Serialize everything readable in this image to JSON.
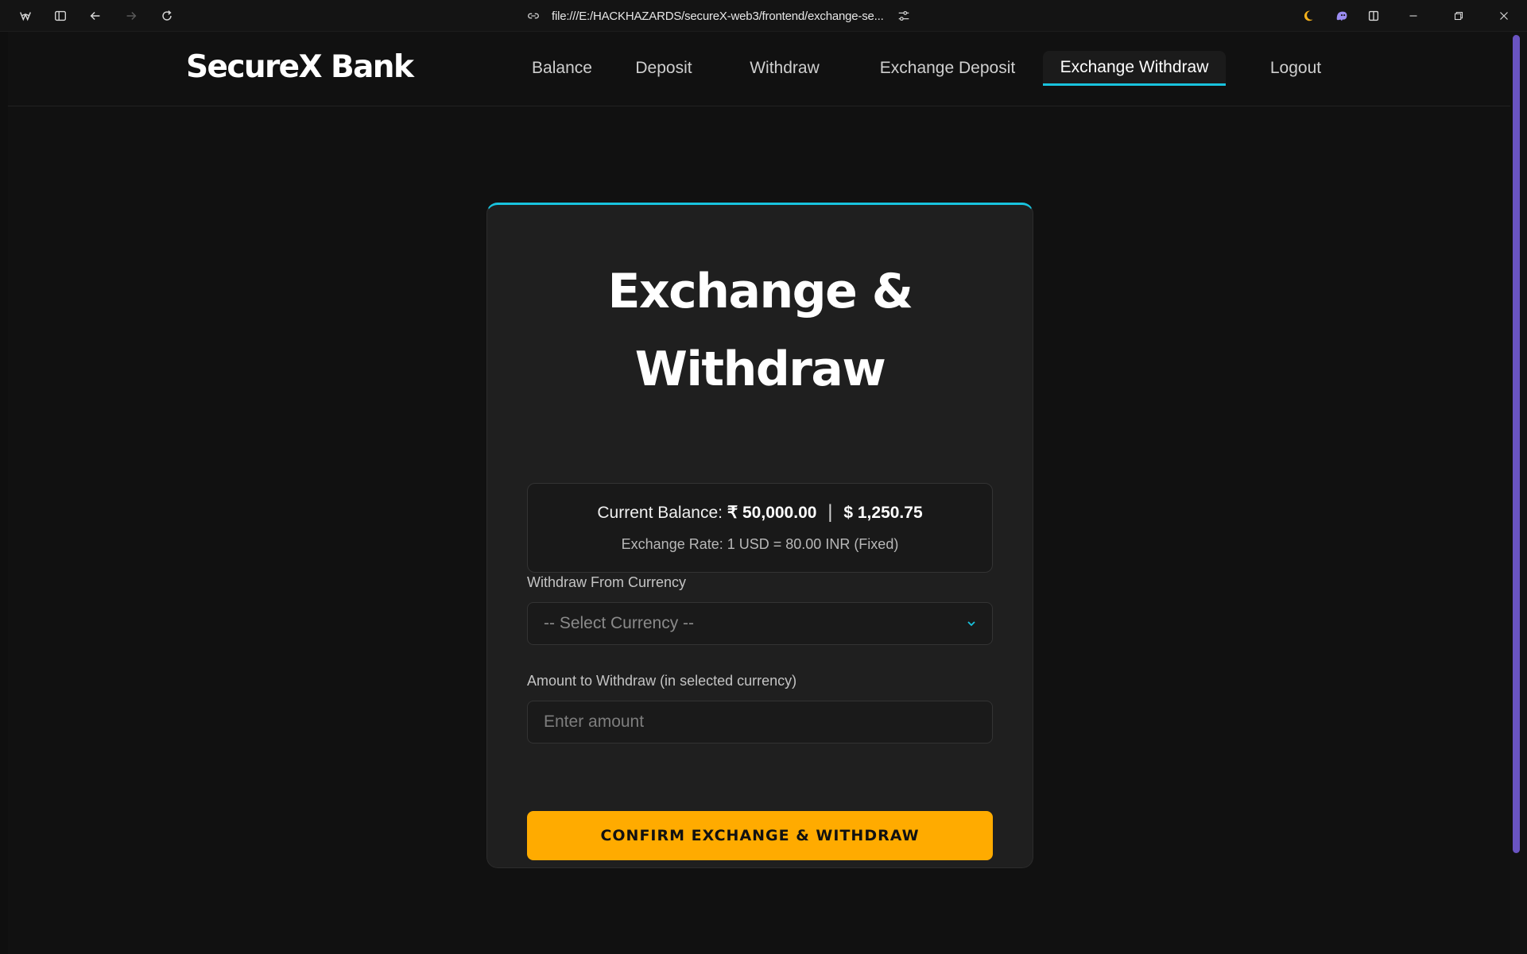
{
  "browser": {
    "url": "file:///E:/HACKHAZARDS/secureX-web3/frontend/exchange-se...",
    "icons": [
      "browser-logo-icon",
      "sidebar-icon",
      "back-arrow-icon",
      "forward-arrow-icon",
      "reload-icon",
      "link-icon",
      "tune-icon",
      "moon-icon",
      "ghost-extension-icon",
      "split-view-icon",
      "minimize-icon",
      "restore-icon",
      "close-icon"
    ]
  },
  "site": {
    "logo": "SecureX Bank",
    "nav": [
      {
        "label": "Balance",
        "active": false
      },
      {
        "label": "Deposit",
        "active": false
      },
      {
        "label": "Withdraw",
        "active": false
      },
      {
        "label": "Exchange Deposit",
        "active": false
      },
      {
        "label": "Exchange Withdraw",
        "active": true
      },
      {
        "label": "Logout",
        "active": false
      }
    ]
  },
  "card": {
    "title_line1": "Exchange &",
    "title_line2": "Withdraw",
    "balance_label": "Current Balance:",
    "balance_inr": "₹ 50,000.00",
    "balance_sep": "|",
    "balance_usd": "$ 1,250.75",
    "exchange_rate": "Exchange Rate: 1 USD = 80.00 INR (Fixed)",
    "currency_label": "Withdraw From Currency",
    "currency_selected": "-- Select Currency --",
    "amount_label": "Amount to Withdraw (in selected currency)",
    "amount_placeholder": "Enter amount",
    "confirm_label": "CONFIRM EXCHANGE & WITHDRAW"
  },
  "colors": {
    "accent": "#19c3de",
    "button": "#ffab00",
    "scrollbar": "#6a54c2"
  }
}
